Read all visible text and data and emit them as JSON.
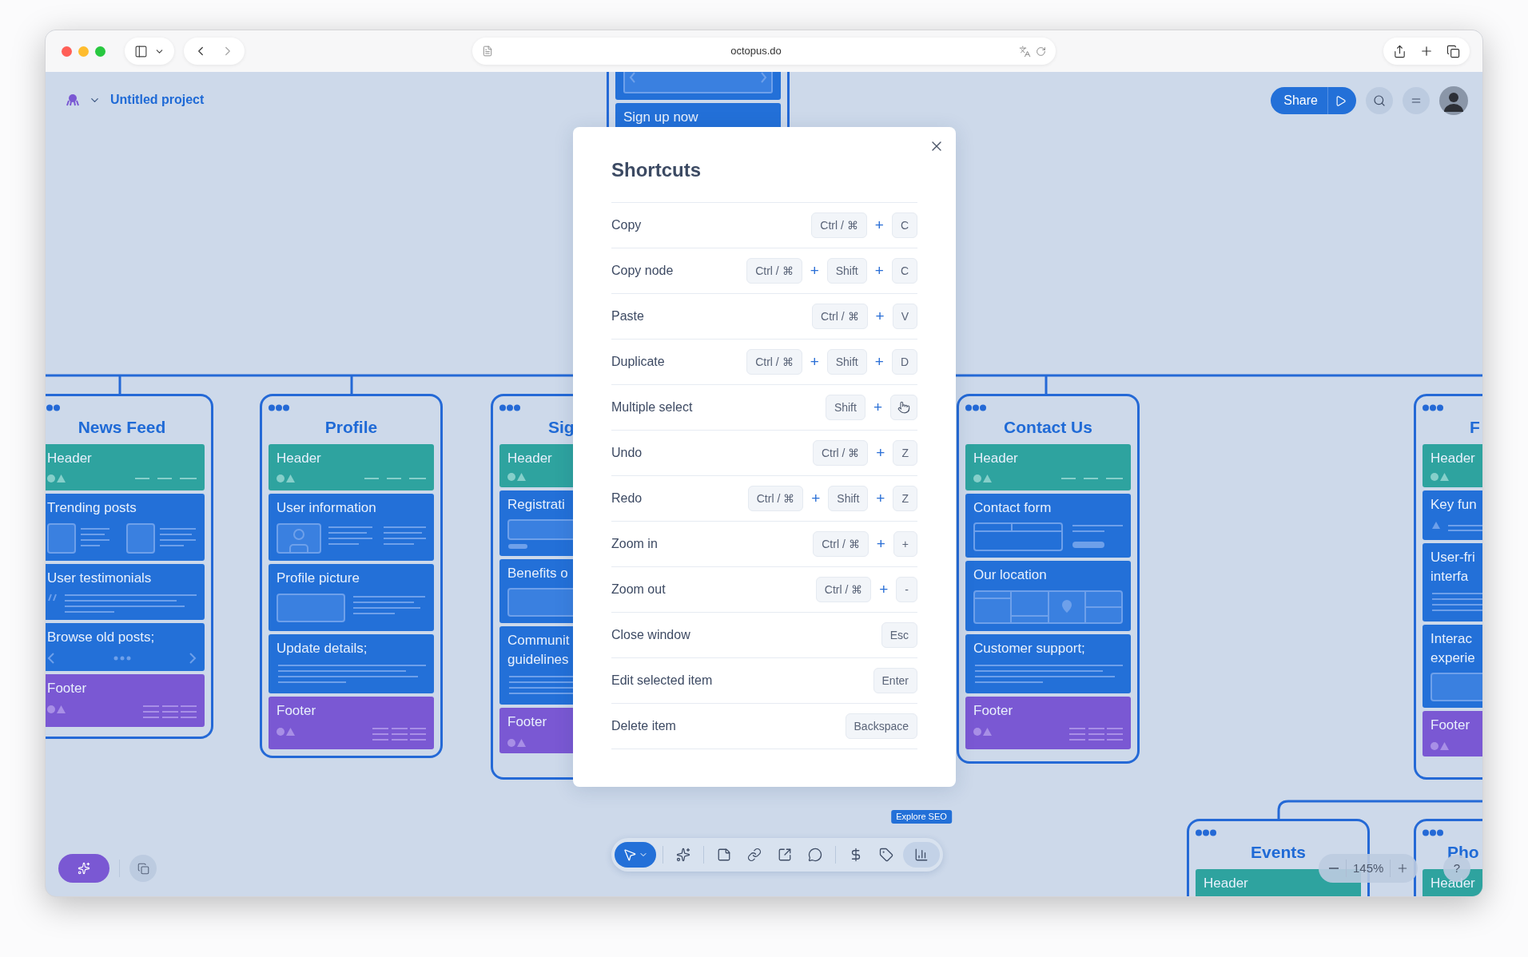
{
  "browser": {
    "url": "octopus.do"
  },
  "project": {
    "name": "Untitled project"
  },
  "share_button": {
    "label": "Share"
  },
  "cards": [
    {
      "title": "News Feed",
      "sections": [
        {
          "title": "Header",
          "kind": "header"
        },
        {
          "title": "Trending posts",
          "kind": "media"
        },
        {
          "title": "User testimonials",
          "kind": "quote"
        },
        {
          "title": "Browse old posts;",
          "kind": "carousel"
        },
        {
          "title": "Footer",
          "kind": "footer"
        }
      ]
    },
    {
      "title": "Profile",
      "sections": [
        {
          "title": "Header",
          "kind": "header"
        },
        {
          "title": "User information",
          "kind": "avatar"
        },
        {
          "title": "Profile picture",
          "kind": "image"
        },
        {
          "title": "Update details;",
          "kind": "lines"
        },
        {
          "title": "Footer",
          "kind": "footer"
        }
      ]
    },
    {
      "title": "Sig",
      "sections": [
        {
          "title": "Header",
          "kind": "header"
        },
        {
          "title": "Registrati",
          "kind": "input"
        },
        {
          "title": "Benefits o",
          "kind": "box"
        },
        {
          "title": "Communit\nguidelines",
          "kind": "lines"
        },
        {
          "title": "Footer",
          "kind": "footer"
        }
      ]
    },
    {
      "title": "Contact Us",
      "sections": [
        {
          "title": "Header",
          "kind": "header"
        },
        {
          "title": "Contact form",
          "kind": "form"
        },
        {
          "title": "Our location",
          "kind": "map"
        },
        {
          "title": "Customer support;",
          "kind": "lines"
        },
        {
          "title": "Footer",
          "kind": "footer"
        }
      ]
    },
    {
      "title": "F",
      "sections": [
        {
          "title": "Header",
          "kind": "header"
        },
        {
          "title": "Key fun",
          "kind": "icon_lines"
        },
        {
          "title": "User-fri\ninterfa",
          "kind": "lines"
        },
        {
          "title": "Interac\nexperie",
          "kind": "box"
        },
        {
          "title": "Footer",
          "kind": "footer"
        }
      ]
    },
    {
      "title": "Events",
      "sections": [
        {
          "title": "Header",
          "kind": "header"
        }
      ]
    },
    {
      "title": "Pho",
      "sections": [
        {
          "title": "Header",
          "kind": "header"
        }
      ]
    },
    {
      "sections": [
        {
          "kind": "slider"
        },
        {
          "title": "Sign up now",
          "kind": "button"
        }
      ]
    }
  ],
  "shortcuts": {
    "title": "Shortcuts",
    "joiner": "+",
    "rows": [
      {
        "label": "Copy",
        "keys": [
          {
            "label": "Ctrl / ⌘"
          },
          {
            "label": "C"
          }
        ]
      },
      {
        "label": "Copy node",
        "keys": [
          {
            "label": "Ctrl / ⌘"
          },
          {
            "label": "Shift"
          },
          {
            "label": "C"
          }
        ]
      },
      {
        "label": "Paste",
        "keys": [
          {
            "label": "Ctrl / ⌘"
          },
          {
            "label": "V"
          }
        ]
      },
      {
        "label": "Duplicate",
        "keys": [
          {
            "label": "Ctrl / ⌘"
          },
          {
            "label": "Shift"
          },
          {
            "label": "D"
          }
        ]
      },
      {
        "label": "Multiple select",
        "keys": [
          {
            "label": "Shift"
          },
          {
            "kind": "pointer"
          }
        ]
      },
      {
        "label": "Undo",
        "keys": [
          {
            "label": "Ctrl / ⌘"
          },
          {
            "label": "Z"
          }
        ]
      },
      {
        "label": "Redo",
        "keys": [
          {
            "label": "Ctrl / ⌘"
          },
          {
            "label": "Shift"
          },
          {
            "label": "Z"
          }
        ]
      },
      {
        "label": "Zoom in",
        "keys": [
          {
            "label": "Ctrl / ⌘"
          },
          {
            "label": "+"
          }
        ]
      },
      {
        "label": "Zoom out",
        "keys": [
          {
            "label": "Ctrl / ⌘"
          },
          {
            "label": "-"
          }
        ]
      },
      {
        "label": "Close window",
        "keys": [
          {
            "label": "Esc"
          }
        ]
      },
      {
        "label": "Edit selected item",
        "keys": [
          {
            "label": "Enter"
          }
        ]
      },
      {
        "label": "Delete item",
        "keys": [
          {
            "label": "Backspace"
          }
        ]
      }
    ]
  },
  "toolbar": {
    "tools": [
      {
        "kind": "pointer",
        "selected": true
      },
      {
        "kind": "ai",
        "selected": false
      },
      {
        "kind": "note",
        "selected": false
      },
      {
        "kind": "link",
        "selected": false
      },
      {
        "kind": "export",
        "selected": false
      },
      {
        "kind": "comment",
        "selected": false
      },
      {
        "kind": "price",
        "selected": false
      },
      {
        "kind": "tag",
        "selected": false
      },
      {
        "kind": "seo",
        "selected": false,
        "tooltip": "Explore SEO"
      }
    ]
  },
  "zoom": {
    "level": "145%"
  },
  "help": {
    "label": "?"
  }
}
